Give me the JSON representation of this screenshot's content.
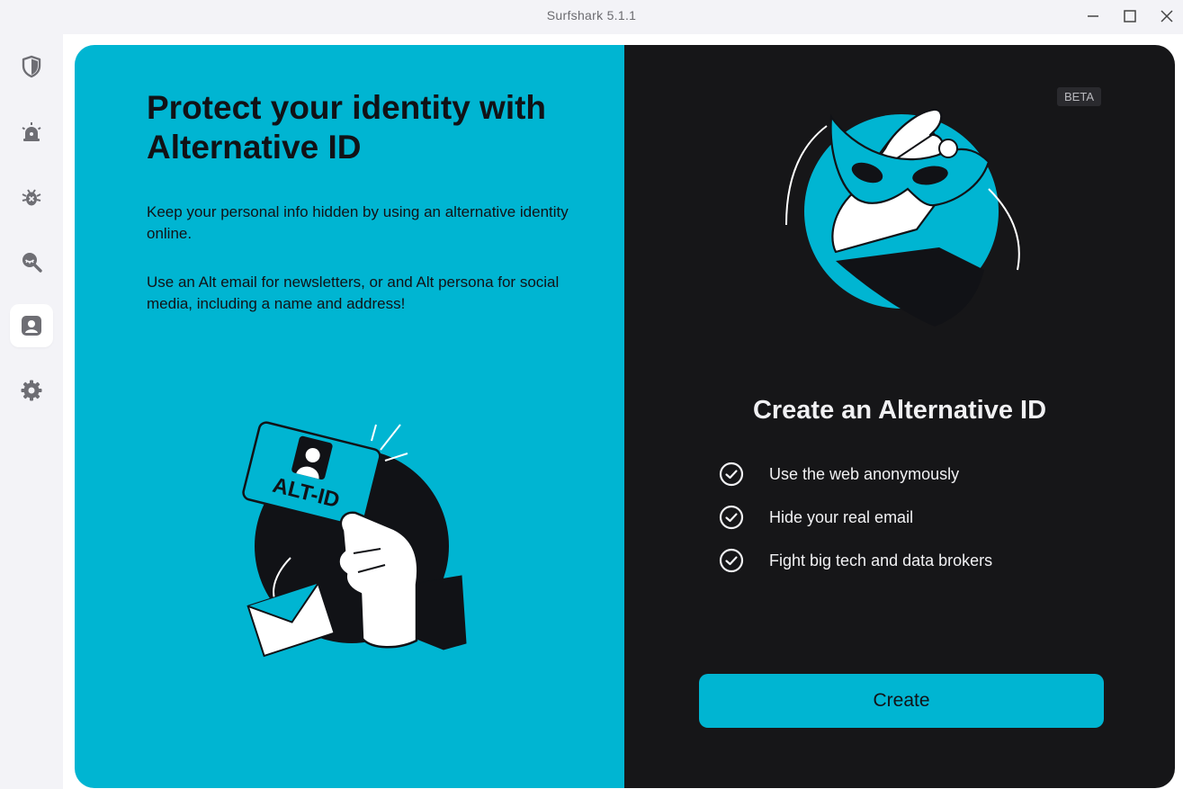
{
  "window": {
    "title": "Surfshark 5.1.1",
    "controls": [
      "minimize",
      "maximize",
      "close"
    ]
  },
  "sidebar": {
    "items": [
      {
        "icon": "shield-icon",
        "active": false
      },
      {
        "icon": "alert-icon",
        "active": false
      },
      {
        "icon": "antivirus-bug-icon",
        "active": false
      },
      {
        "icon": "search-eye-icon",
        "active": false
      },
      {
        "icon": "alternative-id-icon",
        "active": true
      },
      {
        "icon": "gear-icon",
        "active": false
      }
    ]
  },
  "left_panel": {
    "heading": "Protect your identity with Alternative ID",
    "paragraph1": "Keep your personal info hidden by using an alternative identity online.",
    "paragraph2": "Use an Alt email for newsletters, or and Alt persona for social media, including a name and address!",
    "illustration_card_text": "ALT-ID"
  },
  "right_panel": {
    "badge": "BETA",
    "title": "Create an Alternative ID",
    "features": [
      "Use the web anonymously",
      "Hide your real email",
      "Fight big tech and data brokers"
    ],
    "create_label": "Create"
  },
  "colors": {
    "accent": "#00b5d2",
    "dark_panel": "#161618",
    "text_dark": "#111216",
    "text_light": "#f1f1f3"
  }
}
